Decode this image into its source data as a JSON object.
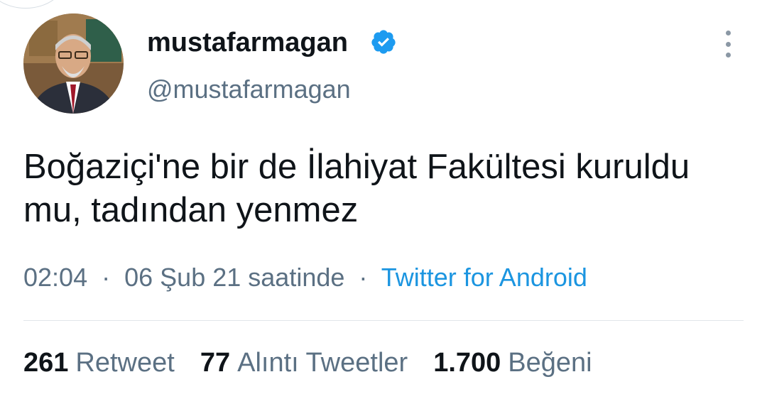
{
  "tweet": {
    "display_name": "mustafarmagan",
    "handle": "@mustafarmagan",
    "verified": true,
    "text": "Boğaziçi'ne bir de İlahiyat Fakültesi kuruldu mu, tadından yenmez",
    "time": "02:04",
    "date": "06 Şub 21 saatinde",
    "separator": "·",
    "source": "Twitter for Android"
  },
  "stats": {
    "retweets_count": "261",
    "retweets_label": "Retweet",
    "quotes_count": "77",
    "quotes_label": "Alıntı Tweetler",
    "likes_count": "1.700",
    "likes_label": "Beğeni"
  },
  "colors": {
    "text_primary": "#0f1419",
    "text_secondary": "#5b7083",
    "link": "#1b95e0",
    "verified_badge": "#1d9bf0"
  },
  "icons": {
    "verified": "verified-badge-icon",
    "more": "more-options-icon"
  }
}
